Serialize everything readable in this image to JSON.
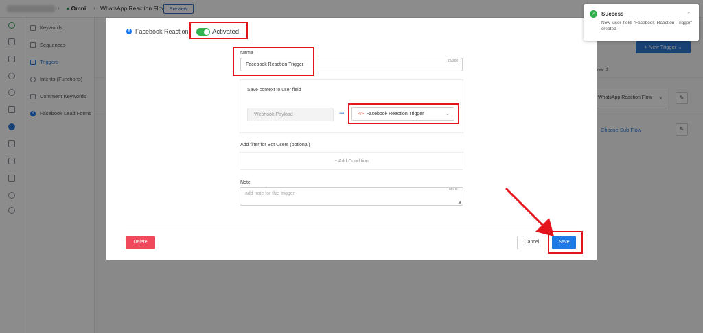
{
  "topbar": {
    "crumb_app": "Omni",
    "crumb_flow": "WhatsApp Reaction Flow",
    "preview_label": "Preview"
  },
  "subnav": {
    "items": [
      {
        "label": "Keywords",
        "icon": "keyword-icon"
      },
      {
        "label": "Sequences",
        "icon": "sequence-icon"
      },
      {
        "label": "Triggers",
        "icon": "trigger-icon",
        "active": true
      },
      {
        "label": "Intents (Functions)",
        "icon": "intent-icon"
      },
      {
        "label": "Comment Keywords",
        "icon": "comment-icon"
      },
      {
        "label": "Facebook Lead Forms",
        "icon": "facebook-icon"
      }
    ]
  },
  "background": {
    "new_trigger_label": "+ New Trigger ⌄",
    "flow_column_header": "ow ⇕",
    "flow_cell_value": "WhatsApp Reaction Flow",
    "choose_sub_flow": "Choose Sub Flow"
  },
  "modal": {
    "platform_label": "Facebook Reaction",
    "status_label": "Activated",
    "name_label": "Name",
    "name_value": "Facebook Reaction Trigger",
    "name_counter": "25/200",
    "context_label": "Save context to user field",
    "source_value": "Webhook Payload",
    "target_field_value": "Facebook Reaction Trigger",
    "filter_label": "Add filter for Bot Users (optional)",
    "add_condition_label": "+ Add Condition",
    "note_label": "Note:",
    "note_placeholder": "add note for this trigger",
    "note_counter": "0/500",
    "delete_label": "Delete",
    "cancel_label": "Cancel",
    "save_label": "Save"
  },
  "toast": {
    "title": "Success",
    "message": "New user field \"Facebook Reaction Trigger\" created",
    "close": "×"
  },
  "colors": {
    "accent": "#1f7ae6",
    "toggle_on": "#34b34d",
    "danger": "#f1495c",
    "highlight": "#e5131c",
    "success": "#2eae4a"
  }
}
